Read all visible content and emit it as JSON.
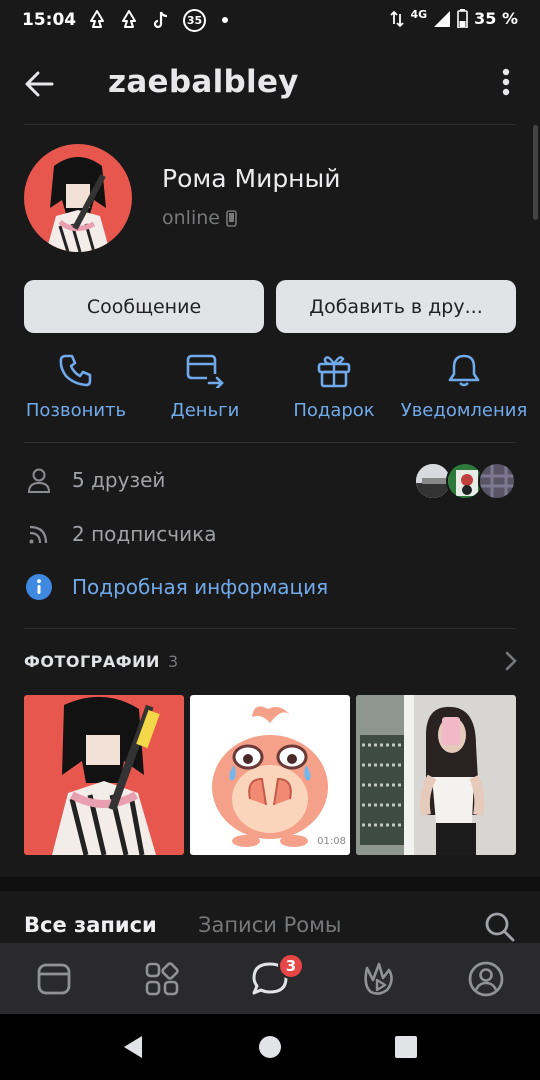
{
  "status_bar": {
    "time": "15:04",
    "notification_badge": "35",
    "network": "4G",
    "battery": "35 %"
  },
  "header": {
    "title": "zaebalbley",
    "back_icon": "arrow-left-icon",
    "more_icon": "more-vertical-icon"
  },
  "profile": {
    "name": "Рома Мирный",
    "status": "online",
    "status_icon": "mobile-phone-icon"
  },
  "buttons": {
    "message": "Сообщение",
    "add_friend": "Добавить в дру..."
  },
  "actions": [
    {
      "label": "Позвонить",
      "icon": "phone-icon"
    },
    {
      "label": "Деньги",
      "icon": "money-transfer-icon"
    },
    {
      "label": "Подарок",
      "icon": "gift-icon"
    },
    {
      "label": "Уведомления",
      "icon": "bell-icon"
    }
  ],
  "info": {
    "friends": "5 друзей",
    "followers": "2 подписчика",
    "details": "Подробная информация"
  },
  "photos": {
    "title": "ФОТОГРАФИИ",
    "count": "3",
    "video_duration": "01:08"
  },
  "posts_tabs": {
    "all": "Все записи",
    "own": "Записи Ромы"
  },
  "bottom_nav": {
    "items": [
      "feed-icon",
      "services-icon",
      "messages-icon",
      "clips-icon",
      "profile-icon"
    ],
    "messages_badge": "3"
  },
  "colors": {
    "background": "#19191a",
    "accent": "#71aaeb",
    "button_bg": "#e1e3e6",
    "badge": "#e64646",
    "info_icon": "#3f8ae0"
  }
}
